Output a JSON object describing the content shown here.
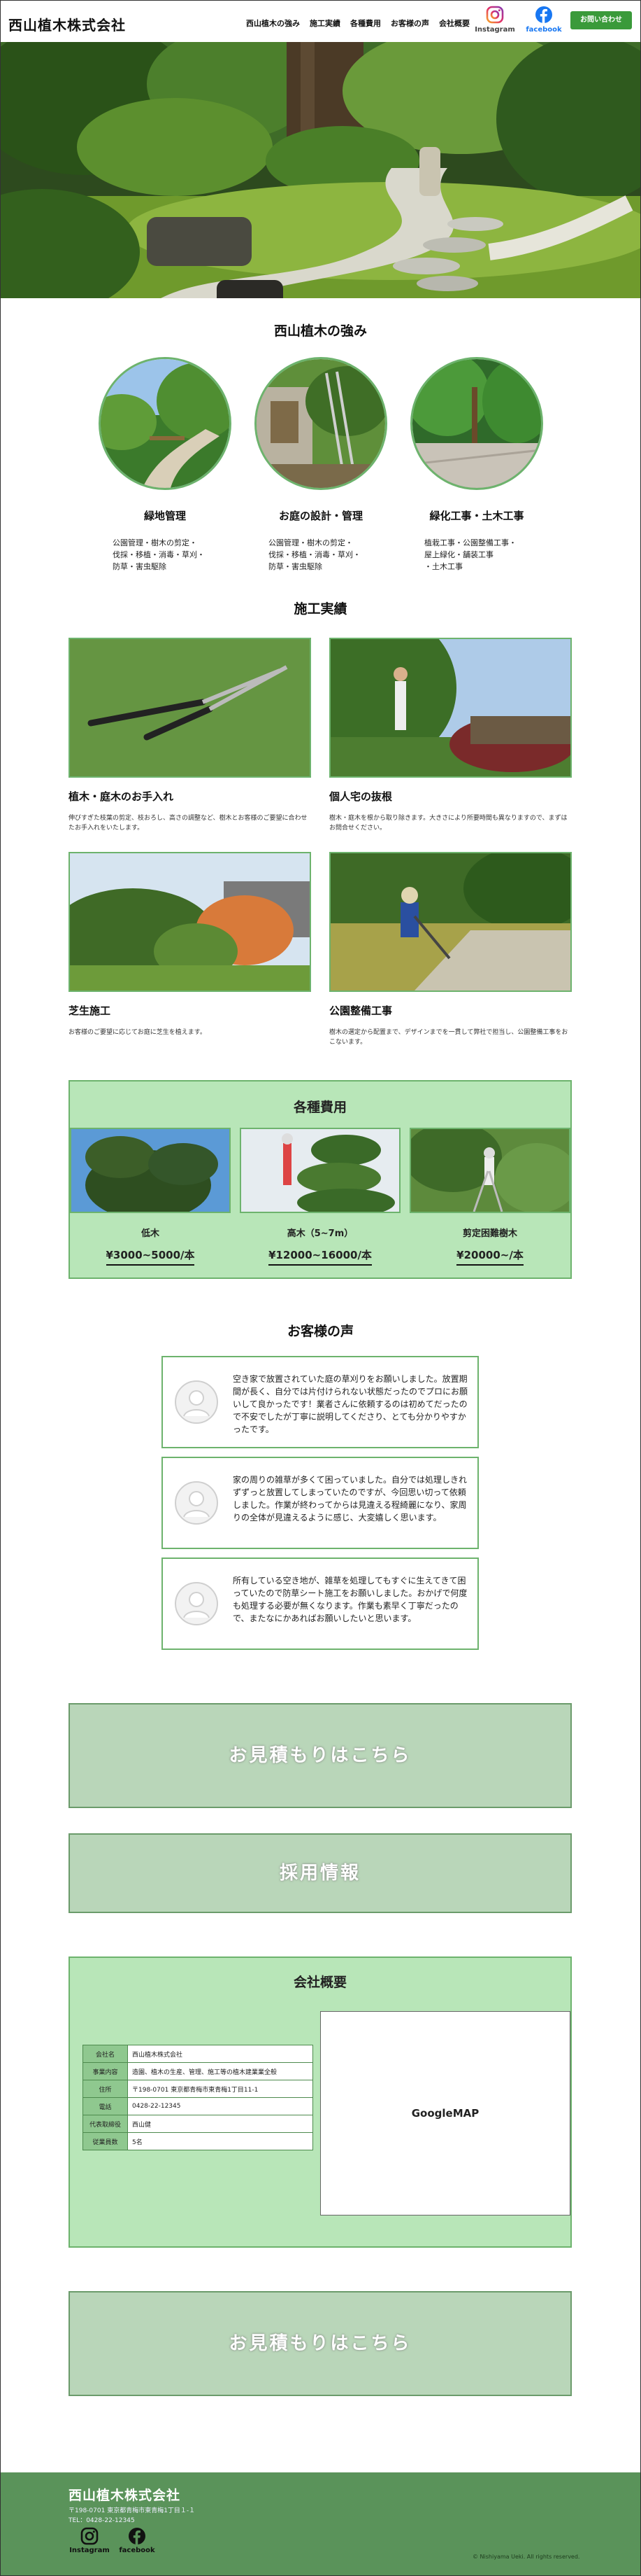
{
  "header": {
    "logo": "西山植木株式会社",
    "nav": [
      "西山植木の強み",
      "施工実績",
      "各種費用",
      "お客様の声",
      "会社概要"
    ],
    "instagram": "Instagram",
    "facebook": "facebook",
    "contact_button": "お問い合わせ"
  },
  "strengths": {
    "title": "西山植木の強み",
    "items": [
      {
        "title": "緑地管理",
        "text": "公園管理・樹木の剪定・\n伐採・移植・消毒・草刈・\n防草・害虫駆除"
      },
      {
        "title": "お庭の設計・管理",
        "text": "公園管理・樹木の剪定・\n伐採・移植・消毒・草刈・\n防草・害虫駆除"
      },
      {
        "title": "緑化工事・土木工事",
        "text": "植栽工事・公園整備工事・\n屋上緑化・舗装工事\n・土木工事"
      }
    ]
  },
  "works": {
    "title": "施工実績",
    "items": [
      {
        "title": "植木・庭木のお手入れ",
        "text": "伸びすぎた枝葉の剪定、枝おろし、高さの調整など、樹木とお客様のご要望に合わせたお手入れをいたします。"
      },
      {
        "title": "個人宅の抜根",
        "text": "樹木・庭木を根から取り除きます。大きさにより所要時間も異なりますので、まずはお問合せください。"
      },
      {
        "title": "芝生施工",
        "text": "お客様のご要望に応じてお庭に芝生を植えます。"
      },
      {
        "title": "公園整備工事",
        "text": "樹木の選定から配置まで、デザインまでを一貫して弊社で担当し、公園整備工事をおこないます。"
      }
    ]
  },
  "pricing": {
    "title": "各種費用",
    "items": [
      {
        "name": "低木",
        "price": "¥3000~5000/本"
      },
      {
        "name": "高木（5~7m）",
        "price": "¥12000~16000/本"
      },
      {
        "name": "剪定困難樹木",
        "price": "¥20000~/本"
      }
    ]
  },
  "voices": {
    "title": "お客様の声",
    "items": [
      "空き家で放置されていた庭の草刈りをお願いしました。放置期間が長く、自分では片付けられない状態だったのでプロにお願いして良かったです！業者さんに依頼するのは初めてだったので不安でしたが丁寧に説明してくださり、とても分かりやすかったです。",
      "家の周りの雑草が多くて困っていました。自分では処理しきれずずっと放置してしまっていたのですが、今回思い切って依頼しました。作業が終わってからは見違える程綺麗になり、家周りの全体が見違えるように感じ、大変嬉しく思います。",
      "所有している空き地が、雑草を処理してもすぐに生えてきて困っていたので防草シート施工をお願いしました。おかげで何度も処理する必要が無くなります。作業も素早く丁寧だったので、またなにかあればお願いしたいと思います。"
    ]
  },
  "banners": {
    "estimate": "お見積もりはこちら",
    "recruit": "採用情報",
    "estimate2": "お見積もりはこちら"
  },
  "company": {
    "title": "会社概要",
    "rows": [
      {
        "key": "会社名",
        "value": "西山植木株式会社"
      },
      {
        "key": "事業内容",
        "value": "造園、植木の生産、管理、施工等の植木建業業全般"
      },
      {
        "key": "住所",
        "value": "〒198-0701 東京都青梅市東青梅1丁目11-1"
      },
      {
        "key": "電話",
        "value": "0428-22-12345"
      },
      {
        "key": "代表取締役",
        "value": "西山健"
      },
      {
        "key": "従業員数",
        "value": "5名"
      }
    ],
    "map": "GoogleMAP"
  },
  "footer": {
    "logo": "西山植木株式会社",
    "address": "〒198-0701 東京都青梅市東青梅1丁目１-１",
    "tel": "TEL：0428-22-12345",
    "instagram": "Instagram",
    "facebook": "facebook",
    "copyright": "© Nishiyama Ueki. All rights reserved."
  },
  "colors": {
    "accent": "#6db36d",
    "panel": "#b8e6b8",
    "footer": "#5a935a",
    "button": "#3a9a3a"
  }
}
